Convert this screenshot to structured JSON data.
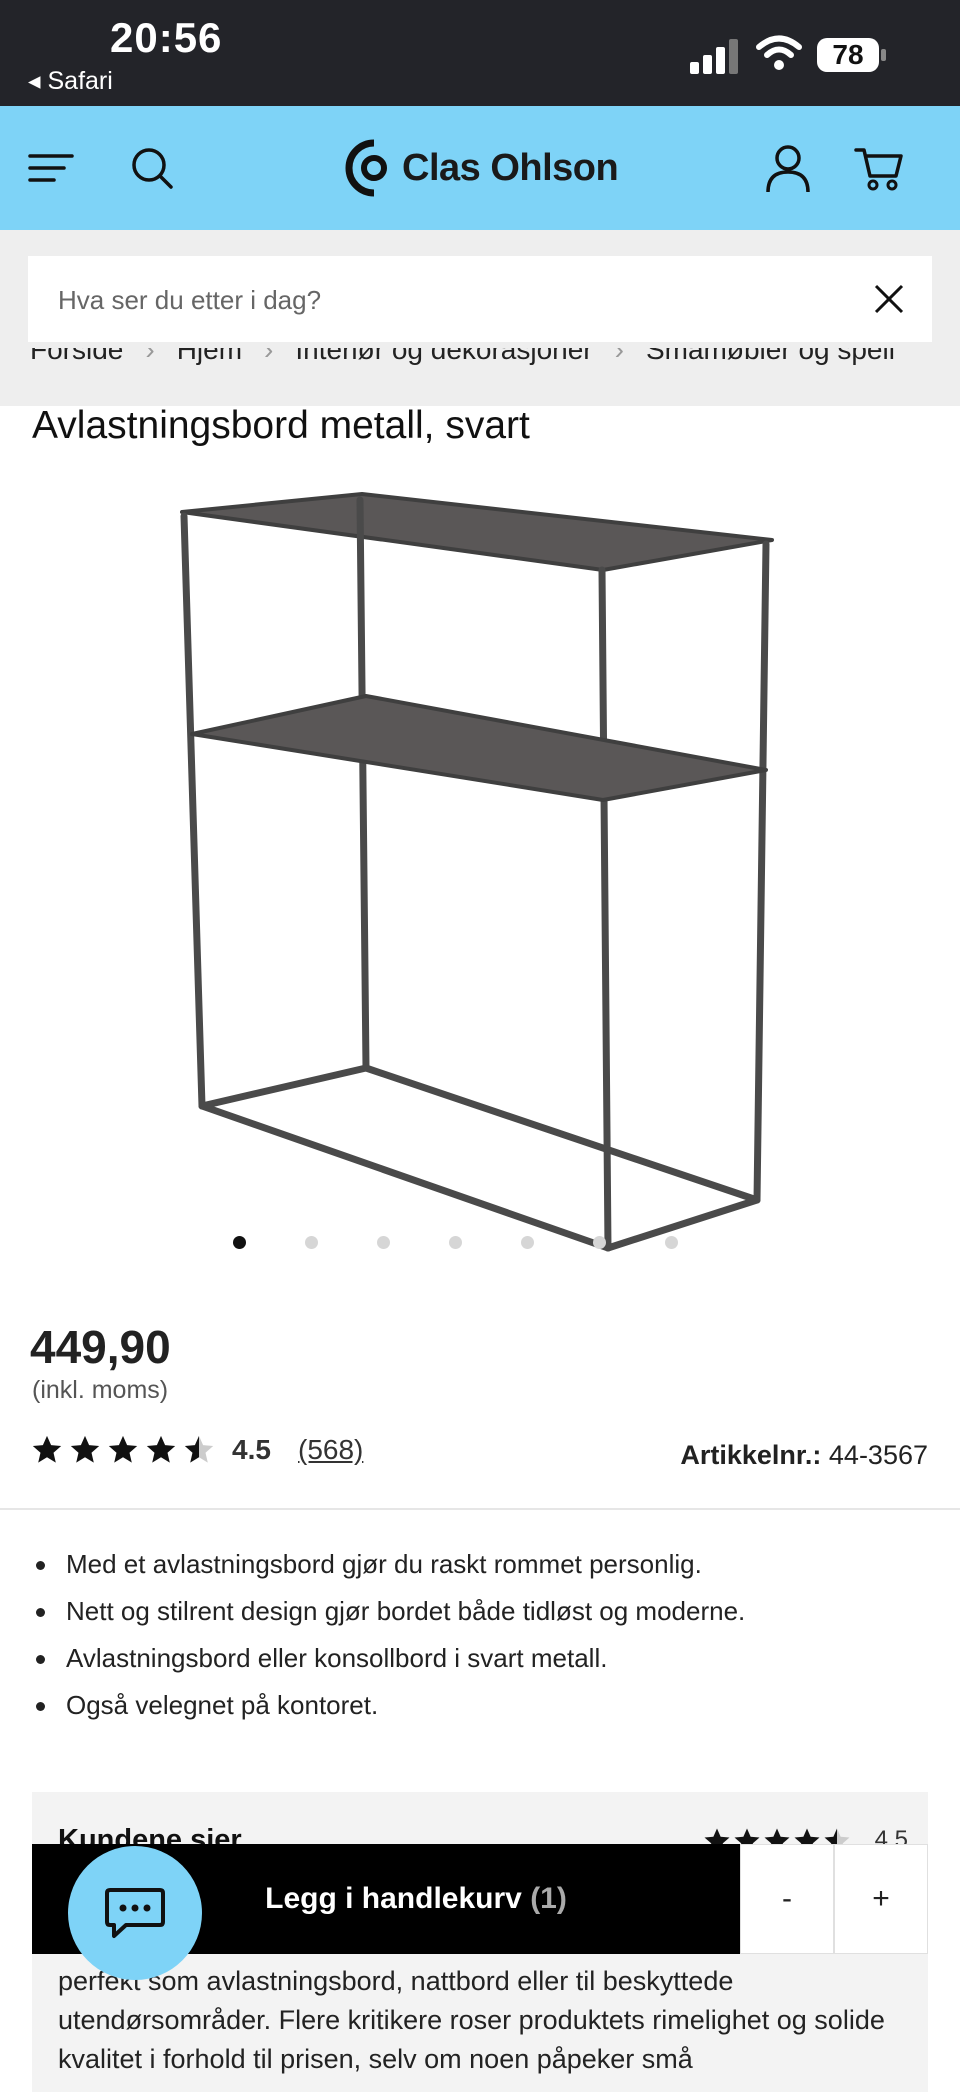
{
  "status_bar": {
    "time": "20:56",
    "back_app": "◂ Safari",
    "battery": "78"
  },
  "header": {
    "brand": "Clas Ohlson",
    "icons": [
      "menu-icon",
      "search-icon",
      "user-icon",
      "cart-icon"
    ],
    "background": "#7ed3f7"
  },
  "search": {
    "placeholder": "Hva ser du etter i dag?",
    "value": ""
  },
  "breadcrumb": [
    "Forside",
    "Hjem",
    "Interiør og dekorasjoner",
    "Småmøbler og speil"
  ],
  "product": {
    "title": "Avlastningsbord metall, svart",
    "image_count": 7,
    "active_image": 1,
    "price": "449,90",
    "vat_note": "(inkl. moms)",
    "rating": "4.5",
    "rating_value": 4.5,
    "review_count": "(568)",
    "article_label": "Artikkelnr.:",
    "article_number": "44-3567",
    "bullets": [
      "Med et avlastningsbord gjør du raskt rommet personlig.",
      "Nett og stilrent design gjør bordet både tidløst og moderne.",
      "Avlastningsbord eller konsollbord i svart metall.",
      "Også velegnet på kontoret."
    ]
  },
  "reviews_summary": {
    "title": "Kundene sier",
    "rating": "4.5",
    "text": "perfekt som avlastningsbord, nattbord eller til beskyttede utendørsområder. Flere kritikere roser produktets rimelighet og solide kvalitet i forhold til prisen, selv om noen påpeker små"
  },
  "cart_bar": {
    "add_label": "Legg i handlekurv",
    "quantity": "(1)",
    "minus": "-",
    "plus": "+"
  },
  "chat": {
    "icon": "chat-icon"
  }
}
